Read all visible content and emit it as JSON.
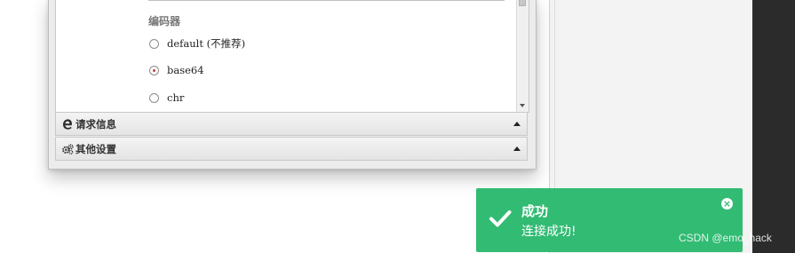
{
  "encoder_section": {
    "label": "编码器",
    "options": [
      {
        "label": "default (不推荐)",
        "checked": false
      },
      {
        "label": "base64",
        "checked": true
      },
      {
        "label": "chr",
        "checked": false
      }
    ]
  },
  "accordion": {
    "request_info": {
      "title": "请求信息",
      "icon": "edge-browser-icon"
    },
    "other_settings": {
      "title": "其他设置",
      "icon": "gears-icon"
    }
  },
  "toast": {
    "title": "成功",
    "message": "连接成功!",
    "icon": "checkmark-icon",
    "close_icon": "close-circle-icon",
    "color": "#32bb73"
  },
  "watermark": {
    "text": "CSDN @emo_hack"
  }
}
